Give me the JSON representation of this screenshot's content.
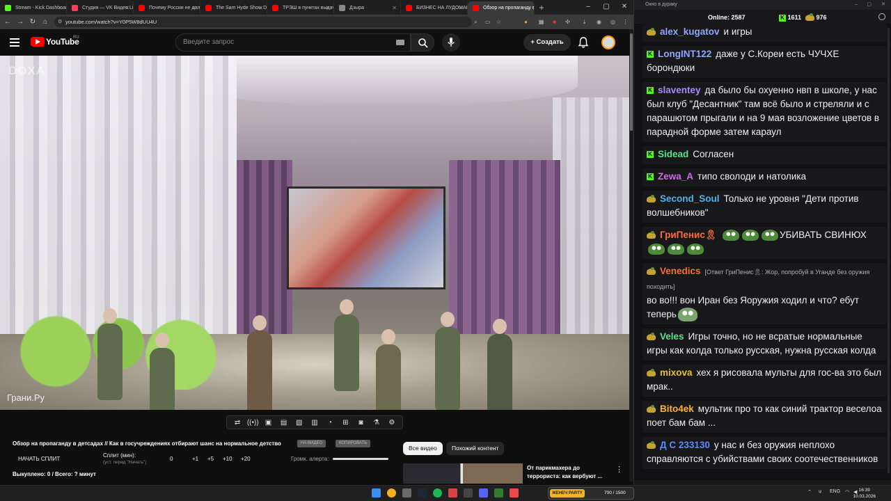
{
  "browser": {
    "tabs": [
      {
        "label": "Stream - Kick Dashboard",
        "color": "#53fc18"
      },
      {
        "label": "Студия — VK Видео Live",
        "color": "#ff3b5c"
      },
      {
        "label": "Почему России не дали…",
        "color": "#ff0000"
      },
      {
        "label": "The Sam Hyde Show D…",
        "color": "#ff0000"
      },
      {
        "label": "ТРЭШ в пунктах выдачи…",
        "color": "#ff0000"
      },
      {
        "label": "Дзыра",
        "color": "#888888"
      },
      {
        "label": "БИЗНЕС НА ЛУДОМАНИИ…",
        "color": "#ff0000"
      },
      {
        "label": "Обзор на пропаганду в…",
        "color": "#ff0000"
      }
    ],
    "new_tab": "+",
    "url": "youtube.com/watch?v=Y0P5W8dUU4U"
  },
  "youtube": {
    "logo_text": "YouTube",
    "country": "RU",
    "search_placeholder": "Введите запрос",
    "create_label": "Создать"
  },
  "video": {
    "watermark_top": "DOXA",
    "watermark_bottom": "Грани.Ру"
  },
  "panel": {
    "title": "Обзор на пропаганду в детсадах // Как в госучреждениях отбирают шанс на нормальное детство",
    "chip1": "НА ВИДЕО",
    "chip2": "КОПИРОВАТЬ",
    "split_button": "НАЧАТЬ СПЛИТ",
    "split_label": "Сплит (мин):",
    "split_hint": "(уст. перед \"Начать\")",
    "split_value": "0",
    "steps": [
      "+1",
      "+5",
      "+10",
      "+20"
    ],
    "volume_label": "Громк. алерта:",
    "counts": "Выкуплено: 0 / Всего: ? минут",
    "filter_all": "Все видео",
    "filter_similar": "Похожий контент",
    "rec_title": "От парикмахера до террориста: как вербуют ..."
  },
  "chat": {
    "window_title": "Окно в дураку",
    "online_label": "Online:",
    "online_count": "2587",
    "kick_count": "1611",
    "vk_count": "976",
    "colors": {
      "kick": "#53fc18",
      "vk": "#c5a233"
    },
    "messages": [
      {
        "platform": "vk",
        "nick": "alex_kugatov",
        "color": "#8fa7ff",
        "text": "и игры"
      },
      {
        "platform": "kick",
        "nick": "LongINT122",
        "color": "#8fa7ff",
        "text": "даже у С.Кореи есть ЧУЧХЕ борондюки"
      },
      {
        "platform": "kick",
        "nick": "slaventey",
        "color": "#b184ff",
        "text": "да было бы охуенно нвп в школе, у нас был клуб \"Десантник\" там всё было и стреляли и с парашютом прыгали и на 9 мая возложение цветов в парадной форме затем караул"
      },
      {
        "platform": "kick",
        "nick": "Sidead",
        "color": "#57e389",
        "text": "Согласен"
      },
      {
        "platform": "kick",
        "nick": "Zewa_A",
        "color": "#d06be8",
        "text": "типо сволоди и натолика"
      },
      {
        "platform": "vk",
        "nick": "Second_Soul",
        "color": "#4fb3e8",
        "text": "Только не уровня \"Дети против волшебников\""
      },
      {
        "platform": "vk",
        "nick": "ГриПенис🎗",
        "color": "#ff6b3d",
        "text": "УБИВАТЬ СВИНЮХ"
      },
      {
        "platform": "vk",
        "nick": "Venedics",
        "color": "#ff6b3d",
        "reply": "[Ответ ГриПенис🎗: Жор, попробуй в Уганде без оружия походить]",
        "text": "во во!!! вон Иран без Яоружия ходил и что? ебут теперь"
      },
      {
        "platform": "vk",
        "nick": "Veles",
        "color": "#57e389",
        "text": "Игры точно, но не всратые нормальные игры как колда только русская, нужна русская колда"
      },
      {
        "platform": "vk",
        "nick": "mixova",
        "color": "#e6c229",
        "text": "хех я рисовала мульты для гос-ва это был мрак.."
      },
      {
        "platform": "vk",
        "nick": "Bito4ek",
        "color": "#ffb13d",
        "text": "мультик про то как синий трактор веселоа поет бам бам ..."
      },
      {
        "platform": "vk",
        "nick": "Д С 233130",
        "color": "#5b8cff",
        "text": "у нас и  без оружия неплохо справляются с убийствами своих соотечественников"
      }
    ]
  },
  "taskbar": {
    "gamebar_label": "ЖЕНЕЧ PARTY",
    "gamebar_count": "700 / 1500",
    "lang": "ENG",
    "time": "16:39",
    "date": "10.03.2026"
  }
}
